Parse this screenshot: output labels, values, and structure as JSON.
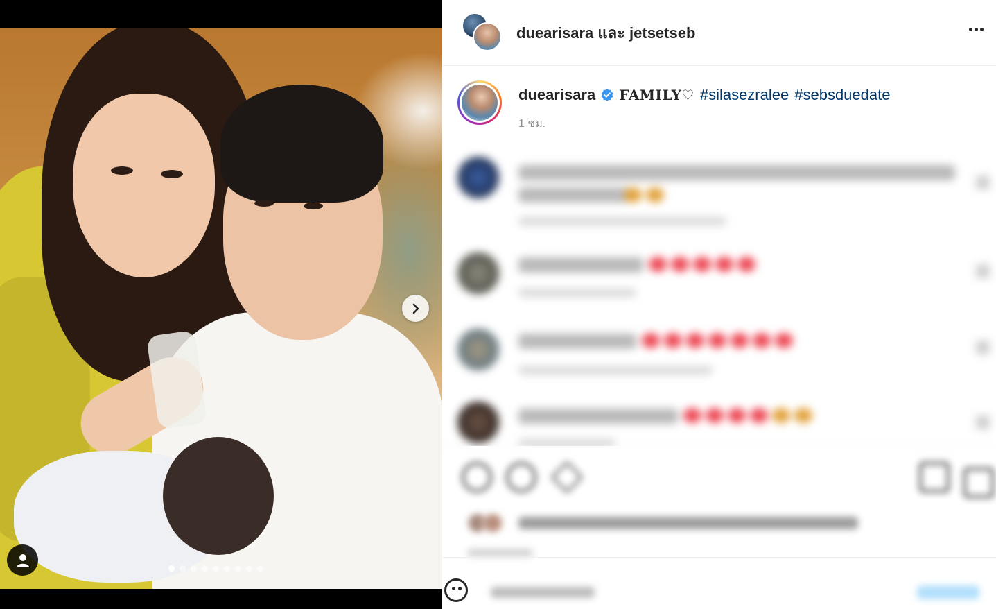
{
  "media": {
    "active_index": 0,
    "slide_count": 9,
    "next_icon": "chevron-right-icon",
    "tag_icon": "user-icon"
  },
  "header": {
    "user1": "duearisara",
    "connector": "และ",
    "user2": "jetsetseb",
    "more_icon": "more-horizontal-icon"
  },
  "caption": {
    "username": "duearisara",
    "verified_icon": "verified-badge-icon",
    "text": "FAMILY♡",
    "hashtags": [
      "#silasezralee",
      "#sebsduedate"
    ],
    "time": "1 ชม."
  },
  "colors": {
    "hashtag": "#00376b",
    "verified": "#3897f0",
    "heart": "#ed4956",
    "muted": "#8e8e8e"
  }
}
